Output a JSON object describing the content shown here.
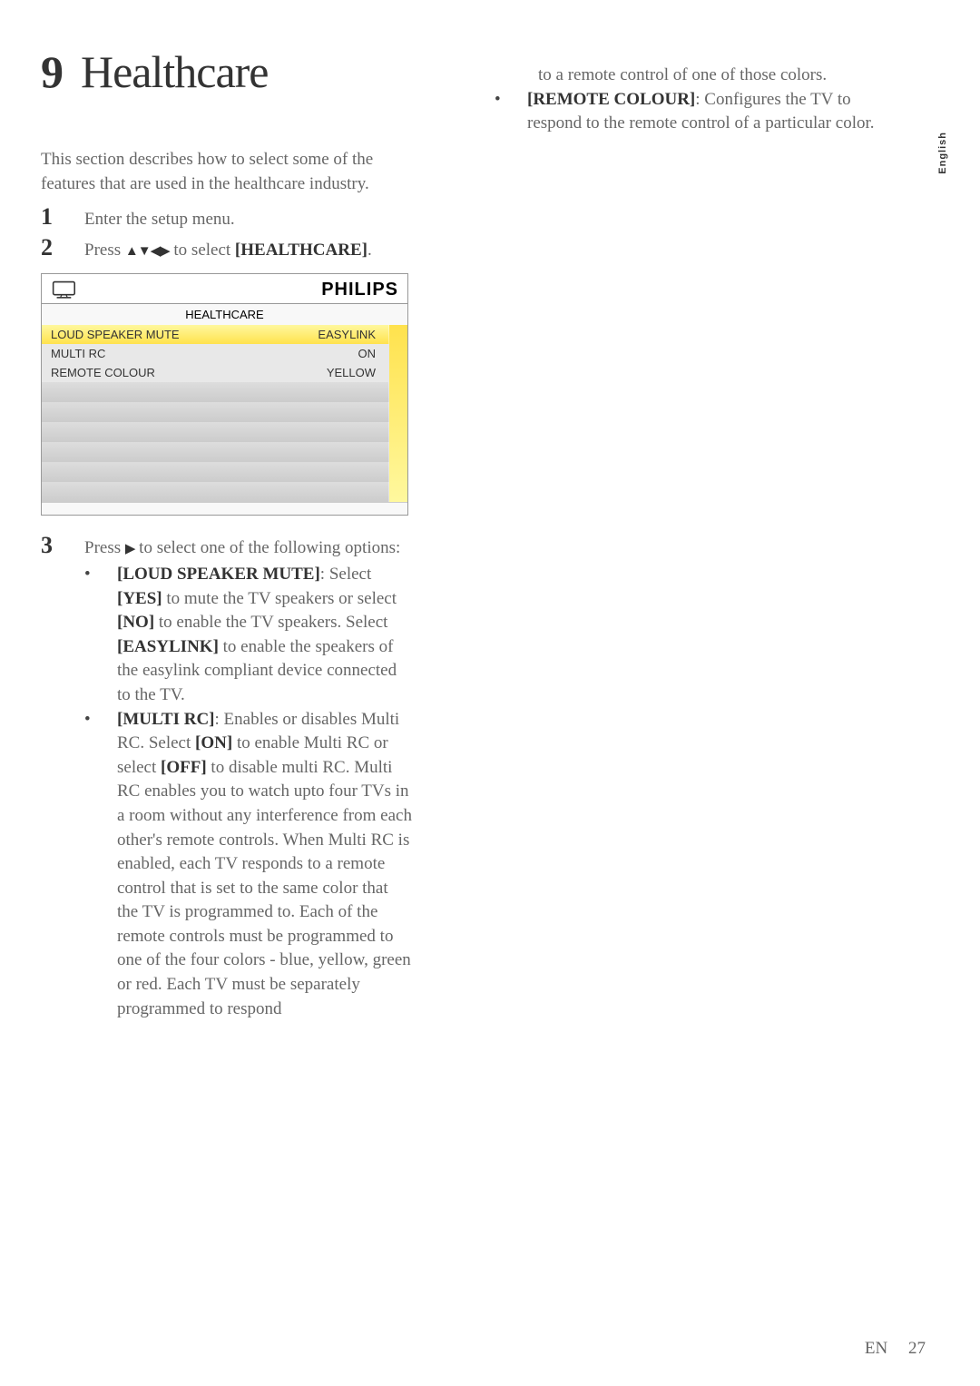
{
  "page": {
    "chapter_num": "9",
    "chapter_title": "Healthcare",
    "intro": "This section describes how to select some of the features that are used in the healthcare industry.",
    "step1_num": "1",
    "step1_text": "Enter the setup menu.",
    "step2_num": "2",
    "step2_prefix": "Press ",
    "step2_suffix": " to select ",
    "step2_target": "[HEALTHCARE]",
    "step2_period": ".",
    "step3_num": "3",
    "step3_prefix": "Press ",
    "step3_suffix": " to select one of the following options:",
    "option1_label": "[LOUD SPEAKER MUTE]",
    "option1_a": ": Select ",
    "option1_yes": "[YES]",
    "option1_b": " to mute the TV speakers or select ",
    "option1_no": "[NO]",
    "option1_c": " to enable the TV speakers. Select ",
    "option1_easy": "[EASYLINK]",
    "option1_d": " to enable the speakers of the easylink compliant device connected to the TV.",
    "option2_label": "[MULTI RC]",
    "option2_a": ": Enables or disables Multi RC. Select ",
    "option2_on": "[ON]",
    "option2_b": " to enable Multi RC or select ",
    "option2_off": "[OFF]",
    "option2_c": " to disable multi RC. Multi RC enables you to watch upto four TVs in a room without any interference from each other's remote controls. When Multi RC is enabled, each TV responds to a remote control that is set to the same color that the TV is programmed to. Each of the remote controls must be programmed to one of the four colors - blue, yellow, green or red. Each TV must be separately programmed to respond",
    "option2_cont": "to a remote control of one of those colors.",
    "option3_label": "[REMOTE COLOUR]",
    "option3_text": ": Configures the TV to respond to the remote control of a particular color.",
    "side_lang": "English",
    "footer_lang": "EN",
    "footer_page": "27"
  },
  "menu": {
    "brand": "PHILIPS",
    "title": "HEALTHCARE",
    "rows": [
      {
        "label": "LOUD SPEAKER MUTE",
        "value": "EASYLINK",
        "hl": true
      },
      {
        "label": "MULTI RC",
        "value": "ON",
        "hl": false
      },
      {
        "label": "REMOTE COLOUR",
        "value": "YELLOW",
        "hl": false
      }
    ]
  }
}
